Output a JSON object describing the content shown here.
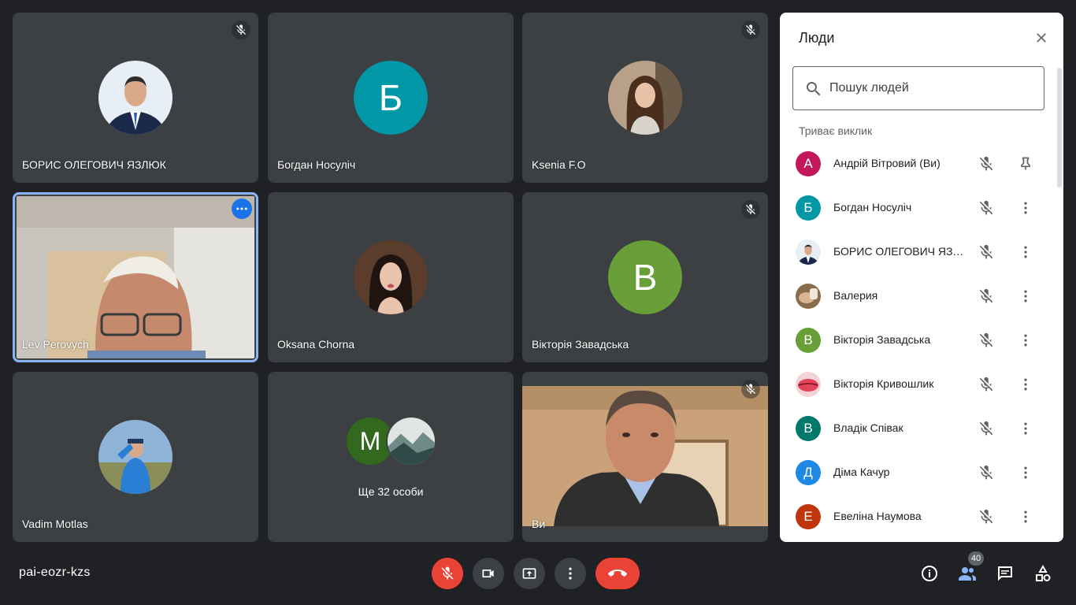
{
  "tiles": {
    "boris": {
      "name": "БОРИС ОЛЕГОВИЧ ЯЗЛЮК",
      "avatar_icon": "photo-man-suit",
      "muted": true
    },
    "bohdan": {
      "name": "Богдан Носуліч",
      "initial": "Б",
      "color": "#0097a7",
      "muted": false
    },
    "ksenia": {
      "name": "Ksenia F.O",
      "avatar_icon": "photo-woman",
      "muted": true
    },
    "lev": {
      "name": "Lev Perovych",
      "video": true,
      "active": true
    },
    "oksana": {
      "name": "Oksana Chorna",
      "avatar_icon": "photo-woman-2",
      "muted": false
    },
    "viktoria": {
      "name": "Вікторія Завадська",
      "initial": "В",
      "color": "#689f38",
      "muted": true
    },
    "vadim": {
      "name": "Vadim Motlas",
      "avatar_icon": "photo-man-outdoor",
      "muted": false
    },
    "more": {
      "initial": "М",
      "label": "Ще 32 особи"
    },
    "you": {
      "name": "Ви",
      "video": true,
      "muted": true
    }
  },
  "panel": {
    "title": "Люди",
    "search_placeholder": "Пошук людей",
    "section_label": "Триває виклик",
    "people": [
      {
        "name": "Андрій Вітровий (Ви)",
        "initial": "А",
        "color": "#c2185b",
        "action_icon": "pin-icon"
      },
      {
        "name": "Богдан Носуліч",
        "initial": "Б",
        "color": "#0097a7",
        "action_icon": "more-vert-icon"
      },
      {
        "name": "БОРИС ОЛЕГОВИЧ ЯЗЛЮК",
        "initial": "",
        "photo": "photo-man-suit",
        "action_icon": "more-vert-icon"
      },
      {
        "name": "Валерия",
        "initial": "",
        "photo": "photo-hands",
        "action_icon": "more-vert-icon"
      },
      {
        "name": "Вікторія Завадська",
        "initial": "В",
        "color": "#689f38",
        "action_icon": "more-vert-icon"
      },
      {
        "name": "Вікторія Кривошлик",
        "initial": "",
        "photo": "photo-red-lips",
        "action_icon": "more-vert-icon"
      },
      {
        "name": "Владік Співак",
        "initial": "В",
        "color": "#00796b",
        "action_icon": "more-vert-icon"
      },
      {
        "name": "Діма Качур",
        "initial": "Д",
        "color": "#1e88e5",
        "action_icon": "more-vert-icon"
      },
      {
        "name": "Евеліна Наумова",
        "initial": "Е",
        "color": "#bf360c",
        "action_icon": "more-vert-icon"
      }
    ]
  },
  "bottom": {
    "meeting_code": "pai-eozr-kzs",
    "participant_count": "40"
  },
  "colors": {
    "background": "#202124",
    "tile": "#3c4043",
    "danger": "#ea4335",
    "accent": "#1a73e8"
  }
}
